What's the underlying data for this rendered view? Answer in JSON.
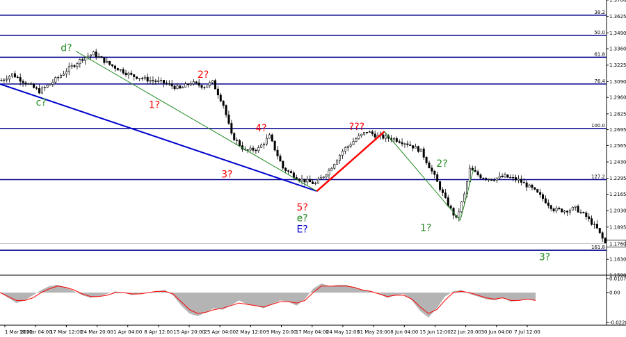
{
  "colors": {
    "background": "#ffffff",
    "candles": "#000000",
    "fib_lines": "#00008b",
    "trendline": "#0000cd",
    "green_line": "#228b22",
    "red_line": "#ff0000",
    "label_red": "#ff0000",
    "label_green": "#228b22",
    "label_blue": "#0000cd",
    "osc_histogram": "#b4b4b4",
    "osc_signal": "#ff0000"
  },
  "chart_data": [
    {
      "type": "candlestick",
      "title": "",
      "instrument": "",
      "x_tick_labels": [
        "1 Mar 2022",
        "10 Mar 04:00",
        "17 Mar 12:00",
        "24 Mar 20:00",
        "1 Apr 04:00",
        "8 Apr 12:00",
        "15 Apr 20:00",
        "25 Apr 04:00",
        "2 May 12:00",
        "9 May 20:00",
        "17 May 04:00",
        "24 May 12:00",
        "31 May 20:00",
        "8 Jun 04:00",
        "15 Jun 12:00",
        "22 Jun 20:00",
        "30 Jun 04:00",
        "7 Jul 12:00"
      ],
      "y_tick_labels": [
        "1.3760",
        "1.3625",
        "1.3490",
        "1.3360",
        "1.3225",
        "1.3090",
        "1.2960",
        "1.2825",
        "1.2695",
        "1.2565",
        "1.2430",
        "1.2295",
        "1.2165",
        "1.2030",
        "1.1895",
        "1.1630",
        "1.1500"
      ],
      "ylim": [
        1.15,
        1.376
      ],
      "current_price": "1.1760",
      "fib_levels": [
        {
          "label": "38.2",
          "price": 1.3635
        },
        {
          "label": "50.0",
          "price": 1.347
        },
        {
          "label": "61.8",
          "price": 1.329
        },
        {
          "label": "76.4",
          "price": 1.307
        },
        {
          "label": "100.0",
          "price": 1.2705
        },
        {
          "label": "127.2",
          "price": 1.2285
        },
        {
          "label": "161.8",
          "price": 1.1705
        }
      ],
      "close_path": [
        [
          0,
          1.31
        ],
        [
          4,
          1.315
        ],
        [
          9,
          1.308
        ],
        [
          14,
          1.301
        ],
        [
          18,
          1.307
        ],
        [
          24,
          1.318
        ],
        [
          30,
          1.328
        ],
        [
          34,
          1.332
        ],
        [
          40,
          1.323
        ],
        [
          48,
          1.314
        ],
        [
          55,
          1.31
        ],
        [
          60,
          1.308
        ],
        [
          66,
          1.303
        ],
        [
          70,
          1.308
        ],
        [
          75,
          1.305
        ],
        [
          78,
          1.3085
        ],
        [
          82,
          1.29
        ],
        [
          85,
          1.265
        ],
        [
          90,
          1.252
        ],
        [
          95,
          1.254
        ],
        [
          99,
          1.264
        ],
        [
          104,
          1.238
        ],
        [
          110,
          1.229
        ],
        [
          116,
          1.225
        ],
        [
          121,
          1.236
        ],
        [
          126,
          1.252
        ],
        [
          131,
          1.262
        ],
        [
          135,
          1.268
        ],
        [
          139,
          1.264
        ],
        [
          145,
          1.262
        ],
        [
          150,
          1.258
        ],
        [
          155,
          1.252
        ],
        [
          160,
          1.231
        ],
        [
          164,
          1.212
        ],
        [
          168,
          1.196
        ],
        [
          171,
          1.216
        ],
        [
          173,
          1.237
        ],
        [
          177,
          1.231
        ],
        [
          181,
          1.229
        ],
        [
          186,
          1.231
        ],
        [
          191,
          1.228
        ],
        [
          196,
          1.221
        ],
        [
          200,
          1.213
        ],
        [
          204,
          1.204
        ],
        [
          208,
          1.203
        ],
        [
          212,
          1.205
        ],
        [
          216,
          1.198
        ],
        [
          220,
          1.188
        ],
        [
          223,
          1.176
        ]
      ],
      "wave_labels": [
        {
          "text": "d?",
          "color": "green",
          "date": "17 Mar 12:00",
          "price": 1.337
        },
        {
          "text": "c?",
          "color": "green",
          "date": "10 Mar 04:00",
          "price": 1.292
        },
        {
          "text": "2?",
          "color": "red",
          "date": "15 Apr 20:00",
          "price": 1.315
        },
        {
          "text": "1?",
          "color": "red",
          "date": "8 Apr 12:00",
          "price": 1.29
        },
        {
          "text": "4?",
          "color": "red",
          "date": "2 May 12:00",
          "price": 1.271
        },
        {
          "text": "3?",
          "color": "red",
          "date": "25 Apr 04:00",
          "price": 1.233
        },
        {
          "text": "???",
          "color": "red",
          "date": "24 May 12:00",
          "price": 1.272
        },
        {
          "text": "5?",
          "color": "red",
          "date": "9 May 20:00",
          "price": 1.206
        },
        {
          "text": "e?",
          "color": "green",
          "date": "9 May 20:00",
          "price": 1.197
        },
        {
          "text": "E?",
          "color": "blue",
          "date": "9 May 20:00",
          "price": 1.188
        },
        {
          "text": "2?",
          "color": "green",
          "date": "15 Jun 12:00",
          "price": 1.242
        },
        {
          "text": "1?",
          "color": "green",
          "date": "8 Jun 04:00",
          "price": 1.189
        },
        {
          "text": "3?",
          "color": "green",
          "date": "7 Jul 12:00",
          "price": 1.165
        }
      ],
      "lines": [
        {
          "name": "blue-trendline",
          "color": "blue",
          "from": [
            0,
            1.307
          ],
          "to": [
            117,
            1.219
          ]
        },
        {
          "name": "green-wave-line-1",
          "color": "green",
          "from": [
            28,
            1.334
          ],
          "to": [
            117,
            1.219
          ]
        },
        {
          "name": "red-wave-line",
          "color": "red",
          "from": [
            117,
            1.219
          ],
          "to": [
            142,
            1.268
          ]
        },
        {
          "name": "green-wave-line-2",
          "color": "green",
          "from": [
            142,
            1.268
          ],
          "to": [
            170,
            1.195
          ]
        },
        {
          "name": "green-wave-line-3",
          "color": "green",
          "from": [
            170,
            1.195
          ],
          "to": [
            175,
            1.238
          ]
        }
      ],
      "xlabel": "",
      "ylabel": "",
      "grid": false,
      "legend": "none"
    },
    {
      "type": "area",
      "name": "oscillator",
      "y_tick_labels": [
        "0.0107",
        "0.00",
        "-0.0228"
      ],
      "ylim": [
        -0.0228,
        0.0107
      ],
      "values": [
        0.0,
        -0.004,
        -0.008,
        -0.006,
        -0.002,
        0.002,
        0.005,
        0.006,
        0.004,
        0.001,
        -0.002,
        -0.004,
        -0.003,
        -0.001,
        0.001,
        0.0,
        -0.002,
        -0.001,
        0.0,
        0.001,
        0.002,
        -0.002,
        -0.01,
        -0.016,
        -0.018,
        -0.015,
        -0.012,
        -0.013,
        -0.01,
        -0.006,
        -0.009,
        -0.01,
        -0.012,
        -0.009,
        -0.006,
        -0.007,
        -0.01,
        -0.005,
        0.003,
        0.007,
        0.005,
        0.006,
        0.006,
        0.004,
        0.002,
        0.001,
        -0.001,
        -0.004,
        -0.002,
        -0.001,
        -0.006,
        -0.014,
        -0.019,
        -0.012,
        -0.003,
        0.001,
        0.002,
        -0.001,
        -0.003,
        -0.005,
        -0.006,
        -0.004,
        -0.007,
        -0.006,
        -0.005,
        -0.006
      ],
      "signal": [
        0.0,
        -0.003,
        -0.006,
        -0.006,
        -0.004,
        0.0,
        0.003,
        0.005,
        0.004,
        0.002,
        -0.001,
        -0.003,
        -0.003,
        -0.002,
        0.0,
        0.0,
        -0.001,
        -0.001,
        0.0,
        0.001,
        0.001,
        -0.001,
        -0.007,
        -0.013,
        -0.016,
        -0.015,
        -0.013,
        -0.012,
        -0.01,
        -0.008,
        -0.009,
        -0.01,
        -0.011,
        -0.009,
        -0.007,
        -0.007,
        -0.008,
        -0.006,
        0.0,
        0.005,
        0.005,
        0.005,
        0.005,
        0.004,
        0.002,
        0.001,
        -0.001,
        -0.003,
        -0.002,
        -0.002,
        -0.005,
        -0.011,
        -0.016,
        -0.013,
        -0.006,
        0.0,
        0.001,
        0.0,
        -0.002,
        -0.004,
        -0.005,
        -0.004,
        -0.006,
        -0.006,
        -0.005,
        -0.006
      ]
    }
  ]
}
